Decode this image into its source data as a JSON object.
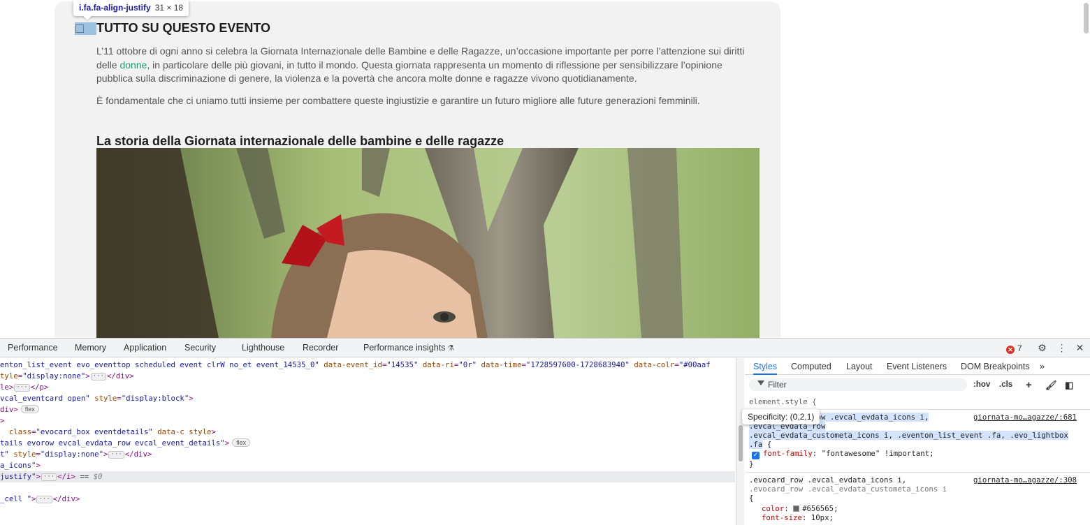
{
  "page": {
    "tooltip": {
      "selector": "i.fa.fa-align-justify",
      "dims": "31 × 18"
    },
    "heading": "TUTTO SU QUESTO EVENTO",
    "para1_a": "L’11 ottobre di ogni anno si celebra la Giornata Internazionale delle Bambine e delle Ragazze, un’occasione importante per porre l’attenzione sui diritti",
    "para1_b_pre": "delle ",
    "para1_b_link": "donne",
    "para1_b_post": ", in particolare delle più giovani, in tutto il mondo. Questa giornata rappresenta un momento di riflessione per sensibilizzare l’opinione",
    "para1_c": "pubblica sulla discriminazione di genere, la violenza e la povertà che ancora molte donne e ragazze vivono quotidianamente.",
    "para2": "È fondamentale che ci uniamo tutti insieme per combattere queste ingiustizie e garantire un futuro migliore alle future generazioni femminili.",
    "subheading": "La storia della Giornata internazionale delle bambine e delle ragazze",
    "link_color": "#1a9e6c"
  },
  "devtools": {
    "tabs": [
      "Performance",
      "Memory",
      "Application",
      "Security",
      "Lighthouse",
      "Recorder",
      "Performance insights"
    ],
    "error_count": "7",
    "icons": [
      "settings-gear-icon",
      "kebab-menu-icon",
      "close-icon"
    ],
    "elements": {
      "line1": {
        "text": "enton_list_event evo_eventtop scheduled  event clrW no_et event_14535_0\"",
        "a1": " data-event_id",
        "v1": "\"14535\"",
        "a2": " data-ri",
        "v2": "\"0r\"",
        "a3": " data-time",
        "v3": "\"1728597600-1728683940\"",
        "a4": " data-colr",
        "v4": "\"#00aaf"
      },
      "line2": {
        "pre": "tyle",
        "val": "\"display:none\"",
        "close": "</div>"
      },
      "line3": {
        "pre": "le>",
        "close": "</p>"
      },
      "line4": {
        "pre": "vcal_eventcard open\"",
        "attr": " style",
        "val": "\"display:block\"",
        "close": ">"
      },
      "line5": {
        "pre": "div>",
        "badge": "flex"
      },
      "line7": {
        "attr1": "class",
        "val1": "\"evocard_box eventdetails\"",
        "attr2": " data-c",
        "attr3": " style",
        "close": ">"
      },
      "line8": {
        "pre": "tails evorow evcal_evdata_row evcal_event_details\"",
        "close": ">",
        "badge": "flex"
      },
      "line9": {
        "pre": "t\"",
        "attr": " style",
        "val": "\"display:none\"",
        "close": "</div>"
      },
      "line10": {
        "pre": "a_icons\"",
        "close": ">"
      },
      "line11": {
        "pre": "justify\"",
        "close": "</i>",
        "eq": " == ",
        "ref": "$0"
      },
      "line13": {
        "pre": "_cell \"",
        "close": "</div>"
      }
    },
    "styles": {
      "tabs": [
        "Styles",
        "Computed",
        "Layout",
        "Event Listeners",
        "DOM Breakpoints",
        "»"
      ],
      "filter_placeholder": "Filter",
      "tools": [
        ":hov",
        ".cls",
        "+"
      ],
      "element_style": "element.style {",
      "rule1_lines": [
        ".evcal_evdata_row .evcal_evdata_icons i,",
        ".evcal_evdata_row",
        ".evcal_evdata_custometa_icons i, .eventon_list_event .fa, .evo_lightbox",
        ".fa"
      ],
      "rule1_source": "giornata-mo…agazze/:681",
      "rule1_prop": "font-family",
      "rule1_value": ": \"fontawesome\" !important;",
      "rule2_lines": [
        ".evocard_row .evcal_evdata_icons i,",
        ".evocard_row .evcal_evdata_custometa_icons i"
      ],
      "rule2_source": "giornata-mo…agazze/:308",
      "rule2_prop": "color",
      "rule2_value": "#656565;",
      "rule2_prop2": "font-size",
      "rule2_value2": ": 10px;",
      "specificity": "Specificity: (0,2,1)"
    }
  }
}
